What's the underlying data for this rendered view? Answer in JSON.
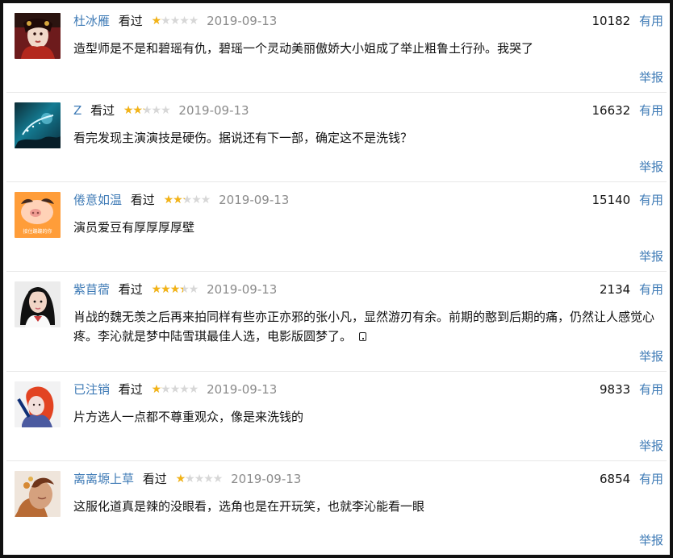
{
  "comments": [
    {
      "username": "杜冰雁",
      "watched": "看过",
      "rating": 1,
      "date": "2019-09-13",
      "useful_count": "10182",
      "useful_label": "有用",
      "text": "造型师是不是和碧瑶有仇，碧瑶一个灵动美丽傲娇大小姐成了举止粗鲁土行孙。我哭了",
      "report_label": "举报",
      "avatar": "period-costume-avatar"
    },
    {
      "username": "Z",
      "watched": "看过",
      "rating": 2,
      "date": "2019-09-13",
      "useful_count": "16632",
      "useful_label": "有用",
      "text": "看完发现主演演技是硬伤。据说还有下一部，确定这不是洗钱？",
      "report_label": "举报",
      "avatar": "underwater-scene-avatar"
    },
    {
      "username": "倦意如温",
      "watched": "看过",
      "rating": 2,
      "date": "2019-09-13",
      "useful_count": "15140",
      "useful_label": "有用",
      "text": "演员爱豆有厚厚厚厚壁",
      "report_label": "举报",
      "avatar": "pig-avatar",
      "avatar_caption": "接住蹦蹦的你"
    },
    {
      "username": "紫苜蓿",
      "watched": "看过",
      "rating": 3,
      "date": "2019-09-13",
      "useful_count": "2134",
      "useful_label": "有用",
      "text": "肖战的魏无羡之后再来拍同样有些亦正亦邪的张小凡，显然游刃有余。前期的憨到后期的痛，仍然让人感觉心疼。李沁就是梦中陆雪琪最佳人选，电影版圆梦了。",
      "report_label": "举报",
      "avatar": "girl-portrait-avatar",
      "mobile_icon": "mobile-phone-icon"
    },
    {
      "username": "已注销",
      "watched": "看过",
      "rating": 1,
      "date": "2019-09-13",
      "useful_count": "9833",
      "useful_label": "有用",
      "text": "片方选人一点都不尊重观众，像是来洗钱的",
      "report_label": "举报",
      "avatar": "red-hair-avatar"
    },
    {
      "username": "离离塬上草",
      "watched": "看过",
      "rating": 1,
      "date": "2019-09-13",
      "useful_count": "6854",
      "useful_label": "有用",
      "text": "这服化道真是辣的没眼看，选角也是在开玩笑，也就李沁能看一眼",
      "report_label": "举报",
      "avatar": "painted-figure-avatar"
    }
  ],
  "colors": {
    "link": "#3f7bb6",
    "star": "#f3b316",
    "star_empty": "#d7d7d7",
    "date": "#8b8b8b"
  }
}
